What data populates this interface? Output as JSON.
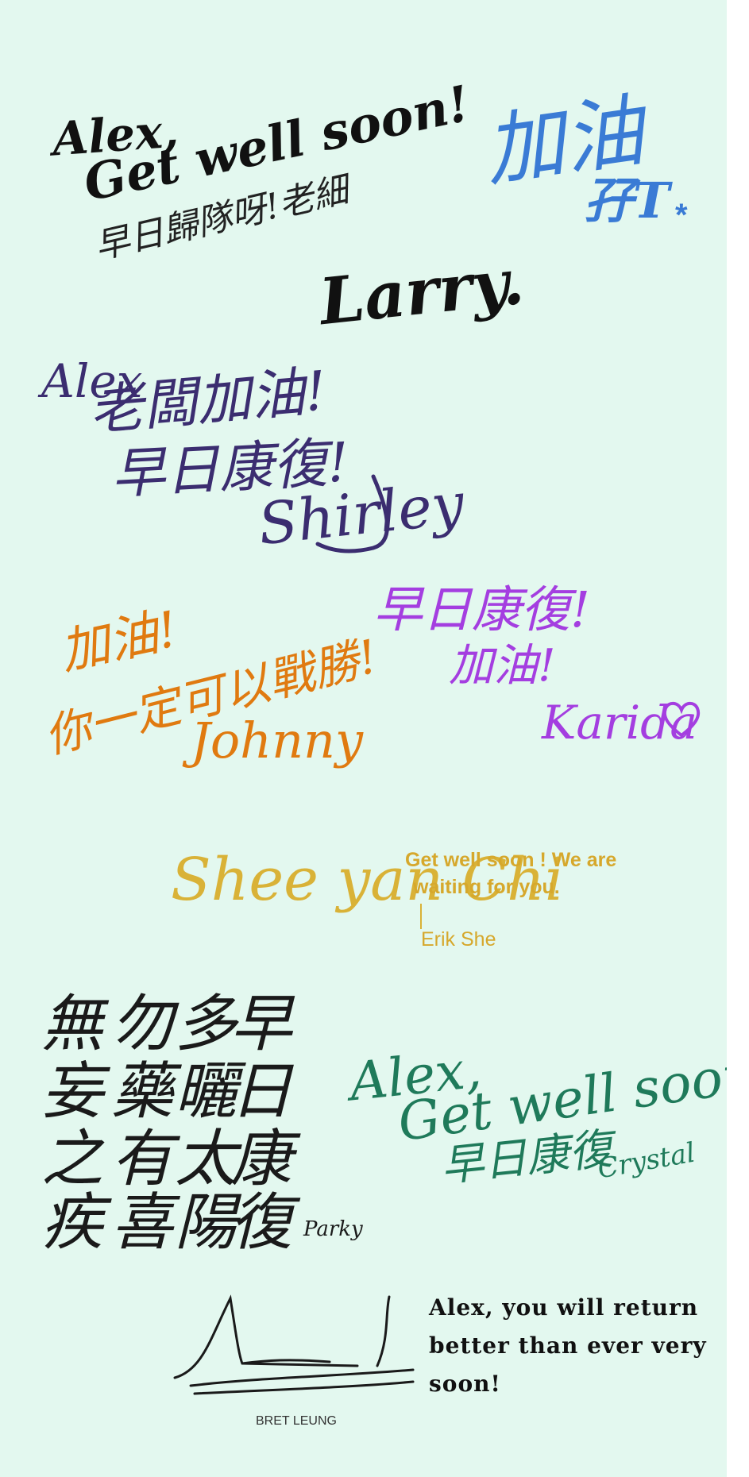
{
  "colors": {
    "background": "#e3f8ef",
    "black": "#111111",
    "blue": "#3a7bd5",
    "navy": "#3b2d70",
    "orange": "#e07a10",
    "violet": "#a43ee0",
    "gold": "#d9b237",
    "gold_text": "#d6a82c",
    "green": "#1f7a5a",
    "brush": "#1a1a1a",
    "gray": "#333333"
  },
  "notes": {
    "larry": {
      "greeting": "Alex,",
      "message": "Get well soon!",
      "chinese": "早日歸隊呀!老細",
      "signature": "Larry."
    },
    "t": {
      "message": "加油",
      "signature": "孖T",
      "mark": "*"
    },
    "shirley": {
      "greeting": "Alex",
      "line1": "老闆加油!",
      "line2": "早日康復!",
      "signature": "Shirley"
    },
    "johnny": {
      "line1": "加油!",
      "line2": "你一定可以戰勝!",
      "signature": "Johnny"
    },
    "karida": {
      "line1": "早日康復!",
      "line2": "加油!",
      "signature": "Karida",
      "heart_icon": "heart-icon"
    },
    "erik": {
      "signature_script": "Shee yan Chi",
      "message_line1": "Get well soon ! We are",
      "message_line2": "waiting for you.",
      "name": "Erik She"
    },
    "parky": {
      "columns": [
        [
          "無",
          "妄",
          "之",
          "疾"
        ],
        [
          "勿",
          "藥",
          "有",
          "喜"
        ],
        [
          "多",
          "曬",
          "太",
          "陽"
        ],
        [
          "早",
          "日",
          "康",
          "復"
        ]
      ],
      "signature": "Parky"
    },
    "crystal": {
      "greeting": "Alex,",
      "message": "Get well soon",
      "chinese": "早日康復",
      "signature": "Crystal"
    },
    "bret": {
      "line1": "Alex, you will return",
      "line2": "better than ever very",
      "line3": "soon!",
      "name": "BRET LEUNG"
    }
  }
}
